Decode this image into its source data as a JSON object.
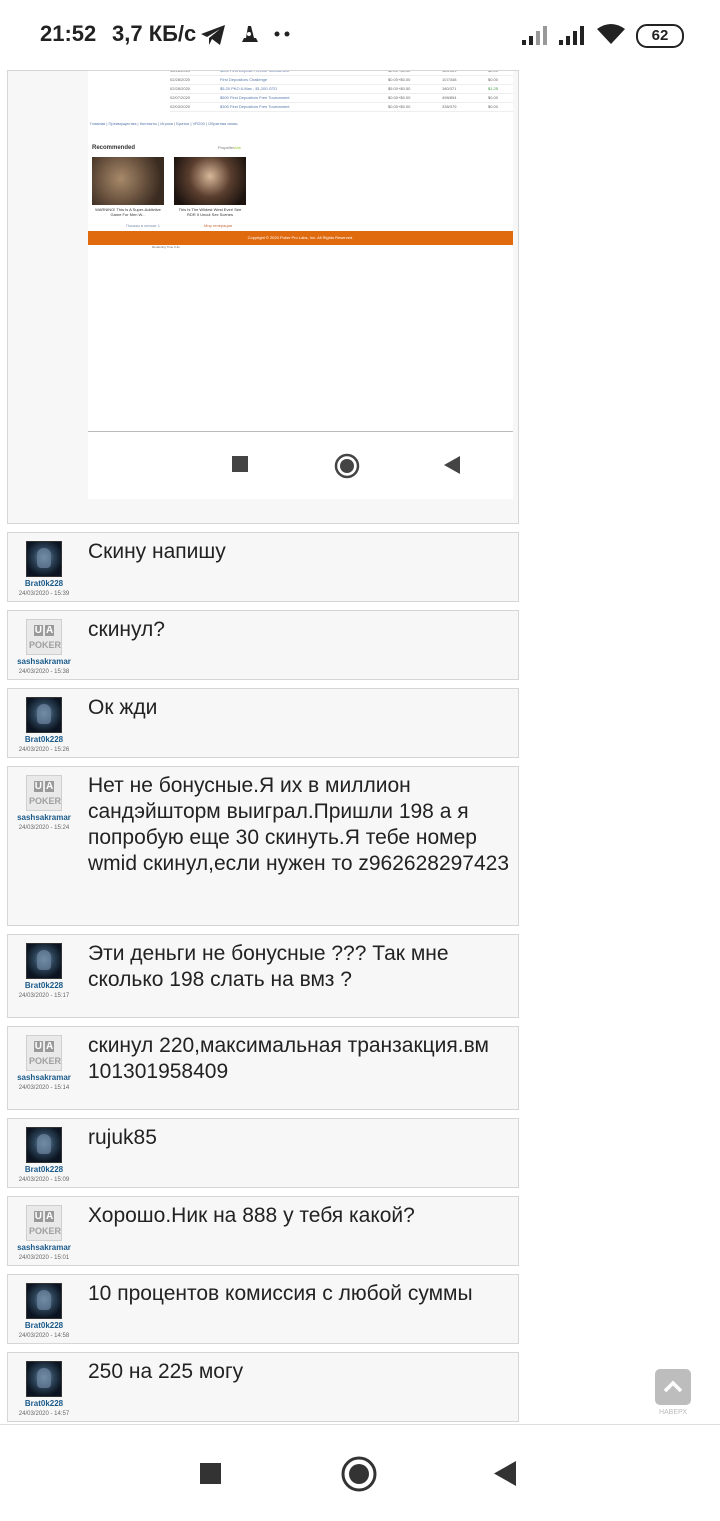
{
  "status_bar": {
    "time": "21:52",
    "speed": "3,7 КБ/с",
    "battery": "62"
  },
  "screenshot": {
    "rows": [
      {
        "date": "03/03/2020",
        "desc": "$500 First Deposit Freeroll Tournament",
        "stake": "$0.00+$0.00",
        "place": "186/339",
        "prize": "$0.00"
      },
      {
        "date": "02/28/2020",
        "desc": "$500 First Deposit Freeroll Tournament",
        "stake": "$0.00+$0.00",
        "place": "180/309",
        "prize": "$0.00"
      },
      {
        "date": "02/28/2020",
        "desc": "First Depositors Challenge",
        "stake": "$0.00+$0.00",
        "place": "107/348",
        "prize": "$0.00"
      },
      {
        "date": "02/28/2020",
        "desc": "$5.20 PKO 6-Max - $1,200 GTD",
        "stake": "$5.00+$0.50",
        "place": "180/371",
        "prize": "$1.25"
      },
      {
        "date": "02/07/2020",
        "desc": "$500 First Depositors Free Tournament",
        "stake": "$0.00+$0.00",
        "place": "498/894",
        "prize": "$0.00"
      },
      {
        "date": "02/03/2020",
        "desc": "$300 First Depositors Free Tournament",
        "stake": "$0.00+$0.00",
        "place": "338/379",
        "prize": "$0.00"
      }
    ],
    "links": "Главная | Преимущества | Контакты | Игроки | Братья | VR200 | Обратная связь",
    "recommended": "Recommended",
    "propeller": "Propeller",
    "propeller_accent": "Ads",
    "ad1_caption": "WARNING! This Is A Super-Addictive Game For Men W...",
    "ad2_caption": "This Is The Wildest West Ever! See RDR II Uncut Sex Scenes",
    "ad_more_left": "Показы в списке 1",
    "ad_more_right": "Мир генерации",
    "footer": "Copyright © 2020 Poker Pro Labs, Inc. All Rights Reserved.",
    "note": "Rendering Time 0.3s"
  },
  "posts": [
    {
      "user": "Brat0k228",
      "date": "24/03/2020 - 15:39",
      "avatar": "dark",
      "text": "Скину напишу"
    },
    {
      "user": "sashsakramar",
      "date": "24/03/2020 - 15:38",
      "avatar": "ua",
      "text": "скинул?"
    },
    {
      "user": "Brat0k228",
      "date": "24/03/2020 - 15:26",
      "avatar": "dark",
      "text": "Ок жди"
    },
    {
      "user": "sashsakramar",
      "date": "24/03/2020 - 15:24",
      "avatar": "ua",
      "text": "Нет не бонусные.Я их  в миллион сандэйшторм выиграл.Пришли 198 а я попробую еще 30 скинуть.Я тебе номер wmid скинул,если нужен то z962628297423"
    },
    {
      "user": "Brat0k228",
      "date": "24/03/2020 - 15:17",
      "avatar": "dark",
      "text": "Эти деньги не бонусные ??? Так мне сколько 198 слать на вмз ?"
    },
    {
      "user": "sashsakramar",
      "date": "24/03/2020 - 15:14",
      "avatar": "ua",
      "text": "скинул 220,максимальная транзакция.вм 101301958409"
    },
    {
      "user": "Brat0k228",
      "date": "24/03/2020 - 15:09",
      "avatar": "dark",
      "text": "rujuk85"
    },
    {
      "user": "sashsakramar",
      "date": "24/03/2020 - 15:01",
      "avatar": "ua",
      "text": "Хорошо.Ник на 888 у тебя какой?"
    },
    {
      "user": "Brat0k228",
      "date": "24/03/2020 - 14:58",
      "avatar": "dark",
      "text": "10 процентов комиссия с любой суммы"
    },
    {
      "user": "Brat0k228",
      "date": "24/03/2020 - 14:57",
      "avatar": "dark",
      "text": "250 на 225 могу"
    }
  ],
  "ua_logo": {
    "u": "U",
    "a": "A",
    "poker": "POKER"
  },
  "to_top_label": "НАВЕРХ"
}
